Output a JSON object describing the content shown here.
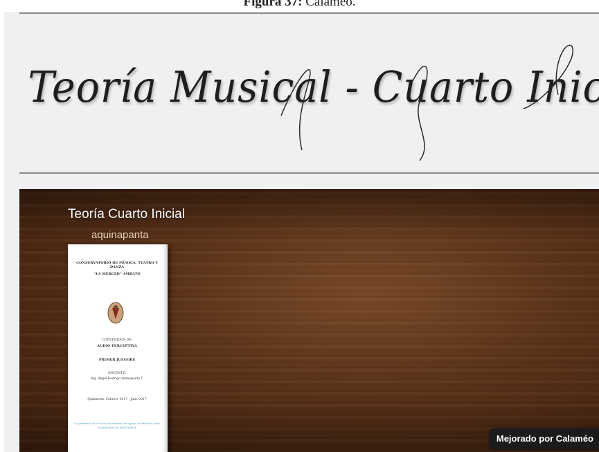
{
  "caption": {
    "label": "Figura 37:",
    "text": "Calaméo."
  },
  "banner": {
    "title": "Teoría Musical  -  Cuarto Inicial"
  },
  "viewer": {
    "document_title": "Teoría Cuarto Inicial",
    "author": "aquinapanta",
    "powered_by": "Mejorado por Calaméo"
  },
  "cover": {
    "institution": "CONSERVATORIO DE MÚSICA, TEATRO Y DANZA",
    "institution_name": "“LA MERCED” AMBATO",
    "contents_label": "CONTENIDOS DE:",
    "subject": "AUDIO PERCEPTIVA",
    "level": "PRIMER JUEGORE",
    "teacher_label": "DOCENTE:",
    "teacher": "Ing. Ángel Rodrigo Quinapanta T.",
    "period": "Quimestre: Febrero 2017 - Julio 2017",
    "footer": "La presente obra es un documento de apoyo académico para estudiantes de nivel inicial"
  },
  "colors": {
    "banner_background": "#eef0f1",
    "wood_dark": "#3b1e0d",
    "wood_light": "#7a4a28",
    "badge_background": "#1b1b1b"
  },
  "icons": {
    "crest": "institution-crest-icon"
  }
}
